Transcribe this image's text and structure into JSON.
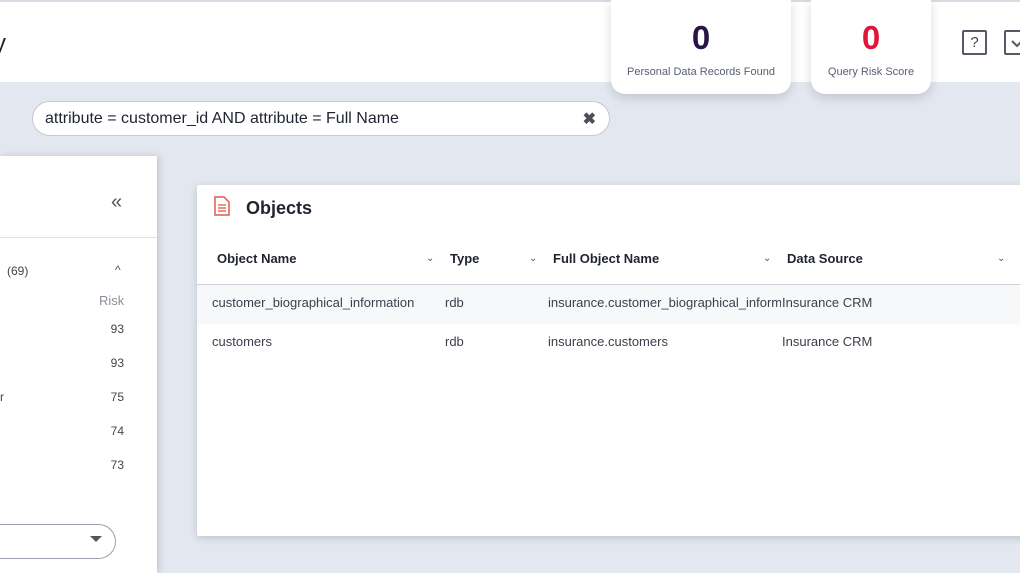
{
  "header": {
    "title": "y"
  },
  "kpis": {
    "records": {
      "value": "0",
      "label": "Personal Data Records Found"
    },
    "risk": {
      "value": "0",
      "label": "Query Risk Score"
    }
  },
  "toolbar": {
    "help_label": "?"
  },
  "search": {
    "query": "attribute = customer_id AND attribute = Full Name",
    "clear_glyph": "✖"
  },
  "sidebar": {
    "collapse_glyph": "«",
    "group_count": "(69)",
    "group_toggle": "^",
    "risk_header": "Risk",
    "rows": [
      {
        "label": "",
        "risk": "93"
      },
      {
        "label": "",
        "risk": "93"
      },
      {
        "label": "r",
        "risk": "75"
      },
      {
        "label": "",
        "risk": "74"
      },
      {
        "label": "",
        "risk": "73"
      }
    ]
  },
  "objects": {
    "title": "Objects",
    "columns": [
      "Object Name",
      "Type",
      "Full Object Name",
      "Data Source"
    ],
    "rows": [
      [
        "customer_biographical_information",
        "rdb",
        "insurance.customer_biographical_information",
        "Insurance CRM"
      ],
      [
        "customers",
        "rdb",
        "insurance.customers",
        "Insurance CRM"
      ]
    ]
  },
  "colors": {
    "kpi_records": "#2a1445",
    "kpi_risk": "#e0153a",
    "card_icon": "#e05a4e"
  }
}
